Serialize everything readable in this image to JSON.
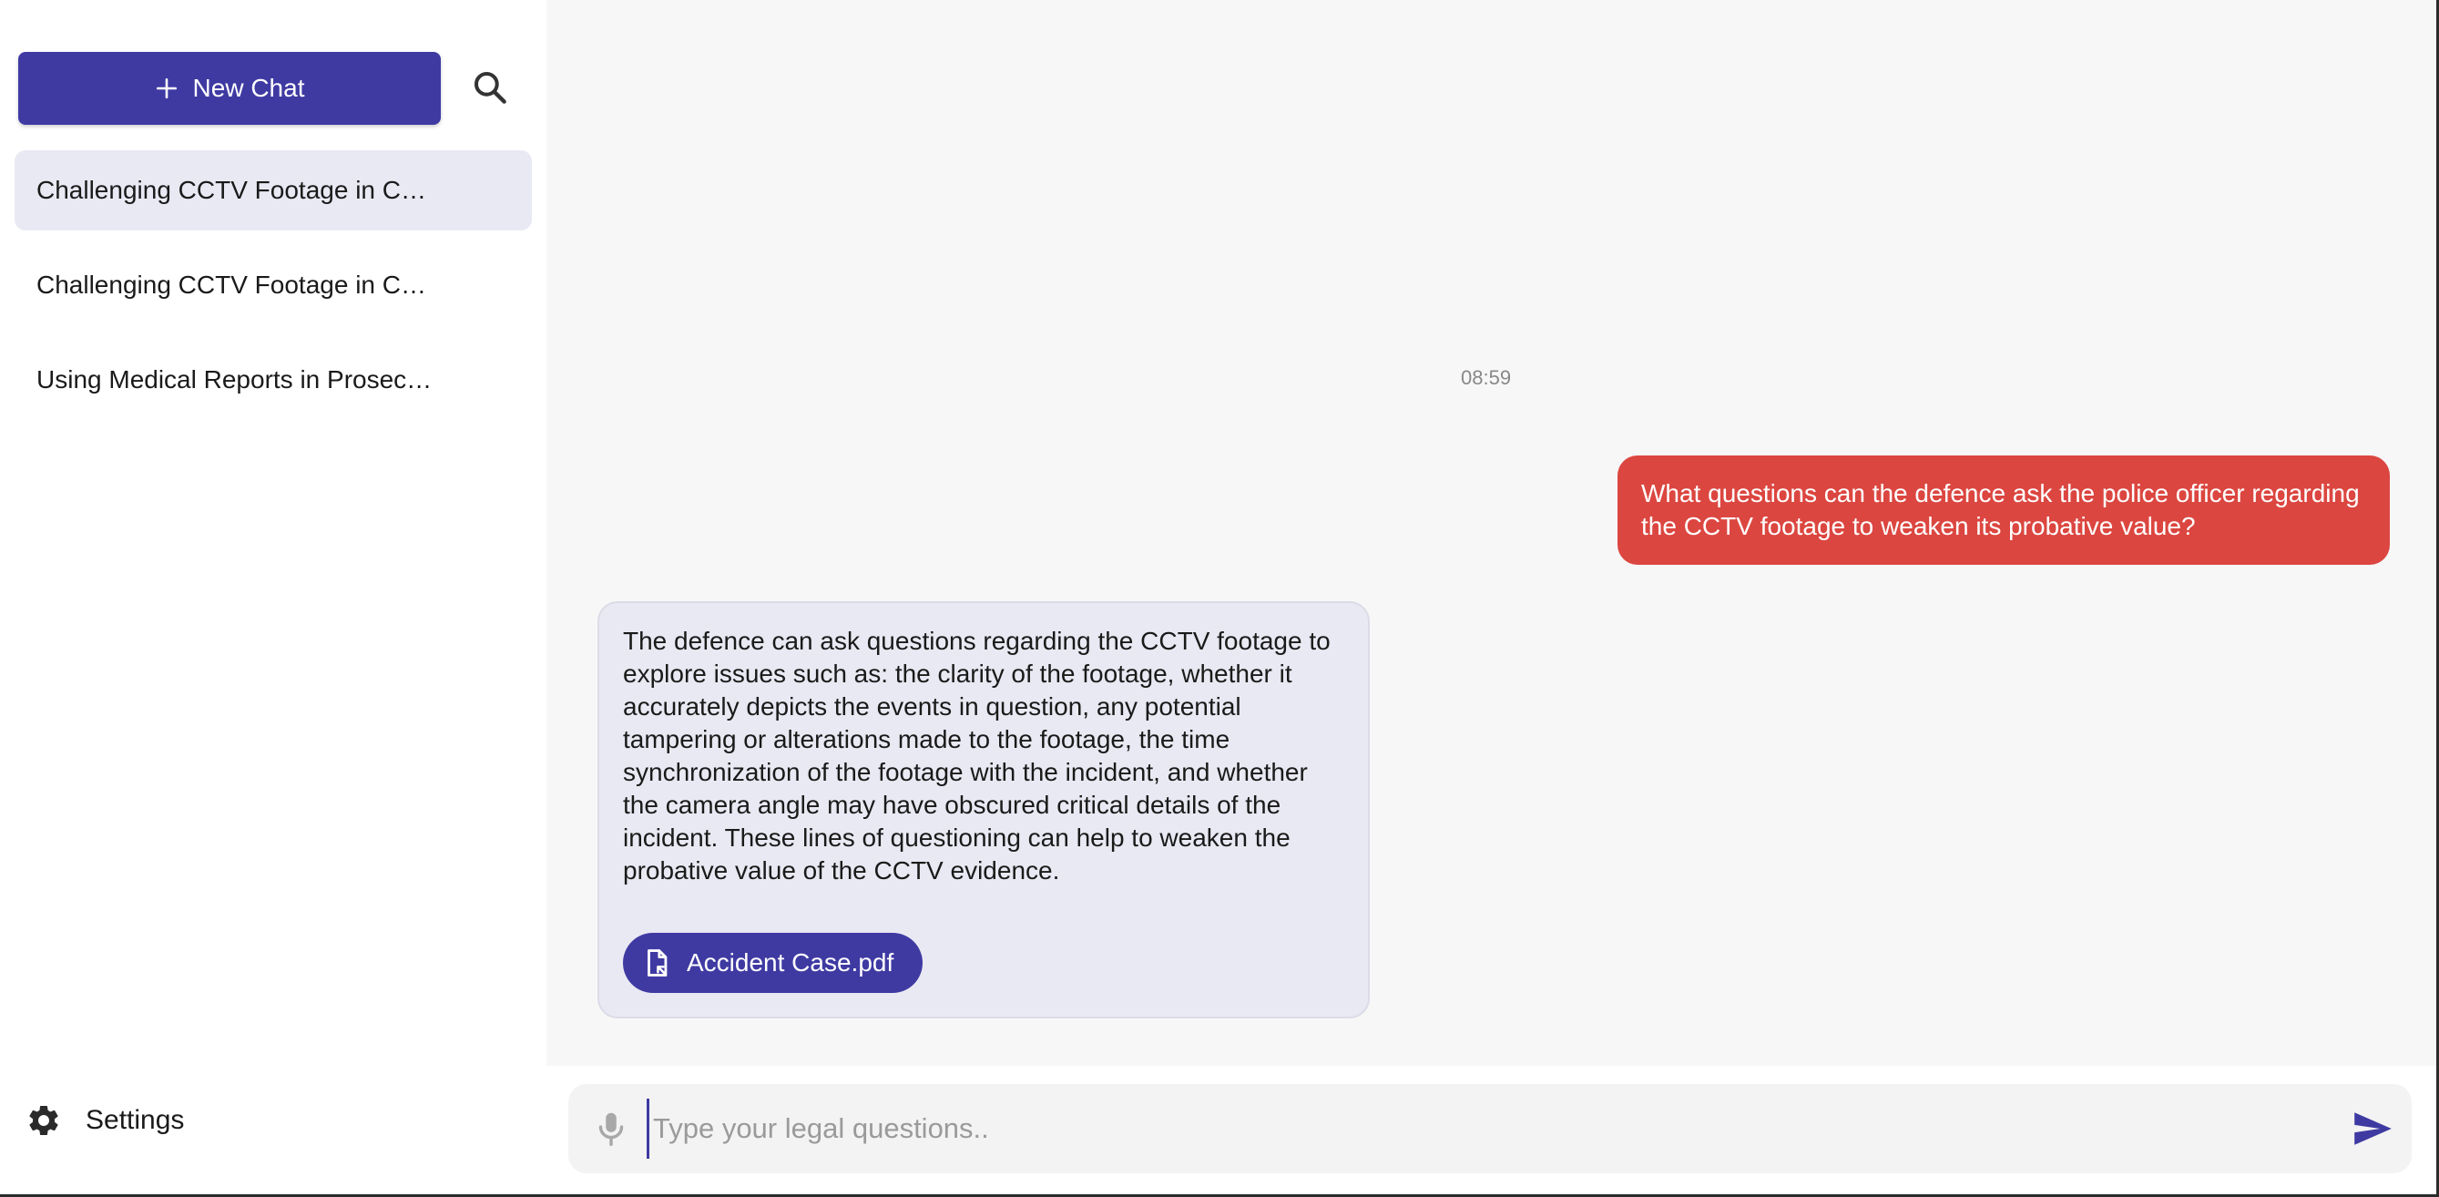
{
  "sidebar": {
    "new_chat_label": "New Chat",
    "conversations": [
      {
        "title": "Challenging CCTV Footage in Court",
        "active": true
      },
      {
        "title": "Challenging CCTV Footage in Court",
        "active": false
      },
      {
        "title": "Using Medical Reports in Prosecution",
        "active": false
      }
    ],
    "settings_label": "Settings"
  },
  "chat": {
    "timestamp": "08:59",
    "user_message": "What questions can the defence ask the police officer regarding the CCTV footage to weaken its probative value?",
    "assistant_message": "The defence can ask questions regarding the CCTV footage to explore issues such as: the clarity of the footage, whether it accurately depicts the events in question, any potential tampering or alterations made to the footage, the time synchronization of the footage with the incident, and whether the camera angle may have obscured critical details of the incident. These lines of questioning can help to weaken the probative value of the CCTV evidence.",
    "attachment_name": "Accident Case.pdf"
  },
  "composer": {
    "placeholder": "Type your legal questions..",
    "value": ""
  },
  "colors": {
    "primary": "#3f3aa2",
    "user_bubble": "#dc4640",
    "assistant_bubble": "#e9e9f3",
    "active_item": "#e9e9f4",
    "main_bg": "#f7f7f7"
  },
  "icons": [
    "plus-icon",
    "search-icon",
    "gear-icon",
    "file-icon",
    "mic-icon",
    "send-icon"
  ]
}
